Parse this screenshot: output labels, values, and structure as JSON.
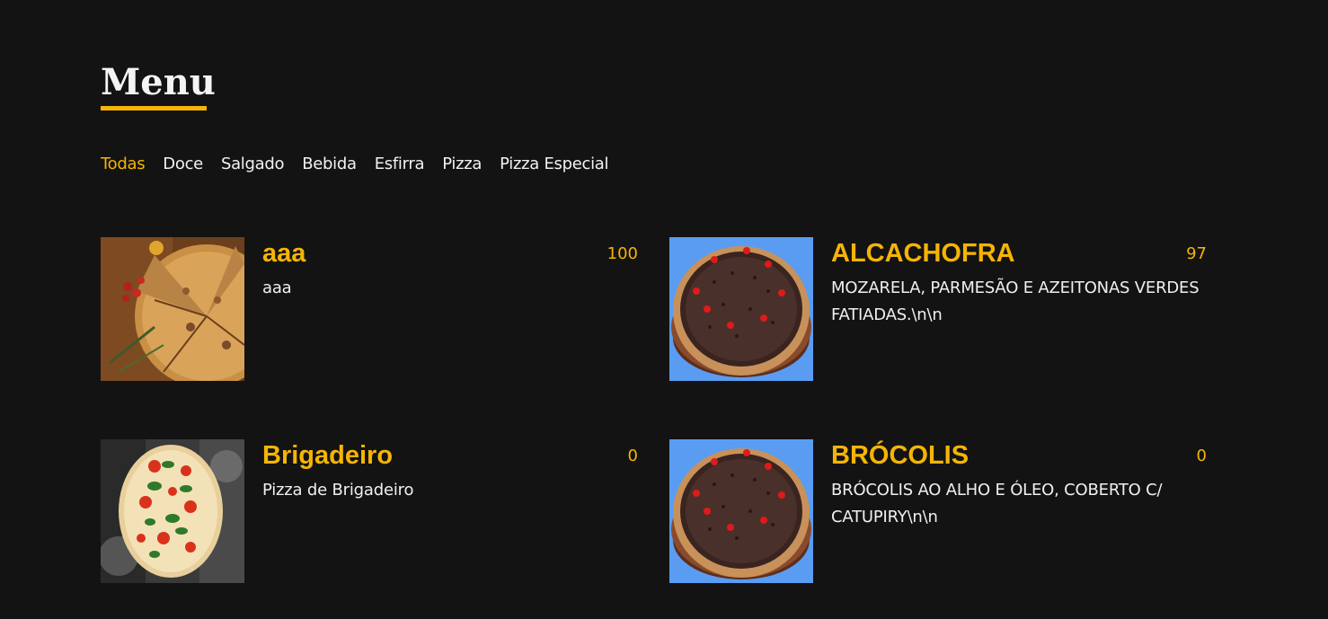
{
  "page": {
    "title": "Menu"
  },
  "colors": {
    "background": "#131313",
    "accent": "#f5b406",
    "text": "#f2f2f2"
  },
  "filters": [
    {
      "label": "Todas",
      "active": true
    },
    {
      "label": "Doce",
      "active": false
    },
    {
      "label": "Salgado",
      "active": false
    },
    {
      "label": "Bebida",
      "active": false
    },
    {
      "label": "Esfirra",
      "active": false
    },
    {
      "label": "Pizza",
      "active": false
    },
    {
      "label": "Pizza Especial",
      "active": false
    }
  ],
  "items": [
    {
      "name": "aaa",
      "price": "100",
      "description": "aaa",
      "image": "pizza-slices-photo"
    },
    {
      "name": "ALCACHOFRA",
      "price": "97",
      "description": "MOZARELA, PARMESÃO E AZEITONAS VERDES FATIADAS.\\n\\n",
      "image": "chocolate-pizza-photo"
    },
    {
      "name": "Brigadeiro",
      "price": "0",
      "description": "Pizza de Brigadeiro",
      "image": "margherita-pizza-photo"
    },
    {
      "name": "BRÓCOLIS",
      "price": "0",
      "description": "BRÓCOLIS AO ALHO E ÓLEO, COBERTO C/ CATUPIRY\\n\\n",
      "image": "chocolate-pizza-photo"
    }
  ]
}
